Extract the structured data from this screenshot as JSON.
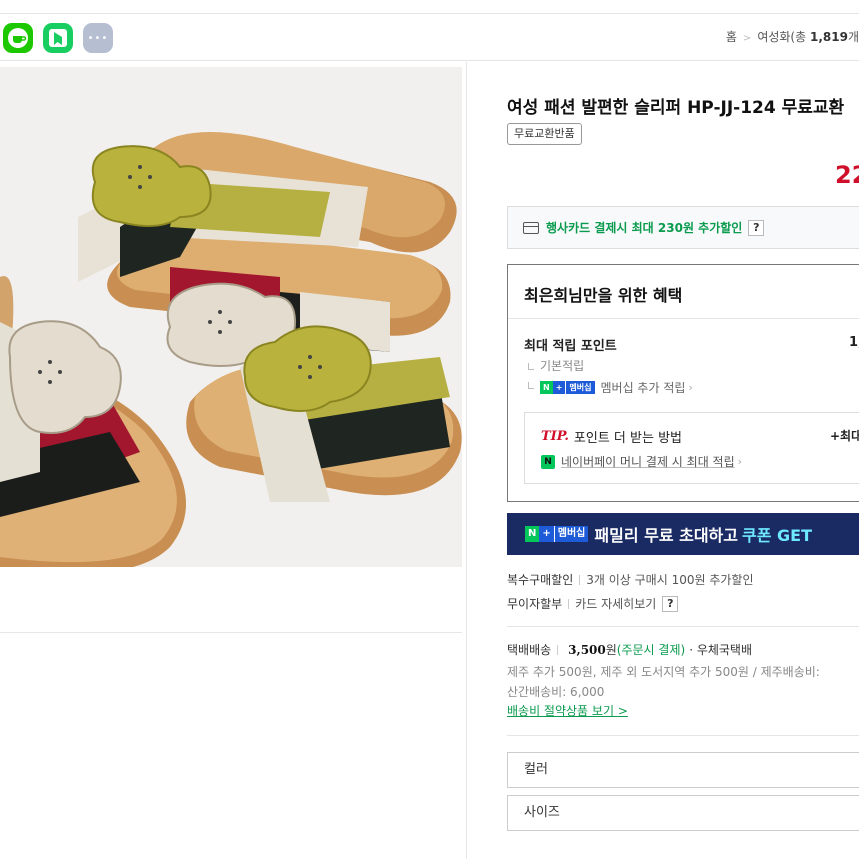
{
  "share": {
    "more_glyph": "•••"
  },
  "breadcrumb": {
    "home": "홈",
    "sep": ">",
    "category": "여성화(총 ",
    "count": "1,819",
    "tail": "개"
  },
  "product": {
    "title": "여성 패션 발편한 슬리퍼 HP-JJ-124 무료교환",
    "tag": "무료교환반품",
    "price": "22"
  },
  "card_promo": {
    "text": "행사카드 결제시 최대 230원 추가할인",
    "help": "?"
  },
  "benefit": {
    "title": "최은희님만을 위한 혜택",
    "points_label": "최대 적립 포인트",
    "points_value": "1,",
    "basic_label": "기본적립",
    "membership_badge": {
      "n": "N",
      "plus": "+",
      "mem": "멤버십"
    },
    "membership_label": "멤버십 추가 적립",
    "tip": {
      "tip_word": "TIP.",
      "title": "포인트 더 받는 방법",
      "right": "+최대",
      "npay_glyph": "N",
      "sub": "네이버페이 머니 결제 시 최대 적립"
    }
  },
  "banner": {
    "badge": {
      "n": "N",
      "plus": "+",
      "mem": "멤버십"
    },
    "text": "패밀리 무료 초대하고",
    "accent": "쿠폰 GET"
  },
  "info": {
    "multi_label": "복수구매할인",
    "multi_value": "3개 이상 구매시 100원 추가할인",
    "installment_label": "무이자할부",
    "installment_value": "카드 자세히보기",
    "installment_help": "?"
  },
  "shipping": {
    "label": "택배배송",
    "fee": "3,500",
    "won": "원",
    "method": "(주문시 결제)",
    "carrier": "· 우체국택배",
    "extra1": "제주 추가 500원, 제주 외 도서지역 추가 500원 / 제주배송비:",
    "extra2": "산간배송비: 6,000",
    "save_link": "배송비 절약상품 보기",
    "save_link_chev": ">"
  },
  "options": {
    "color_label": "컬러",
    "size_label": "사이즈"
  },
  "colors": {
    "accent_green": "#0a9b4e",
    "price_red": "#d00f2b",
    "banner_navy": "#1a2a63"
  }
}
